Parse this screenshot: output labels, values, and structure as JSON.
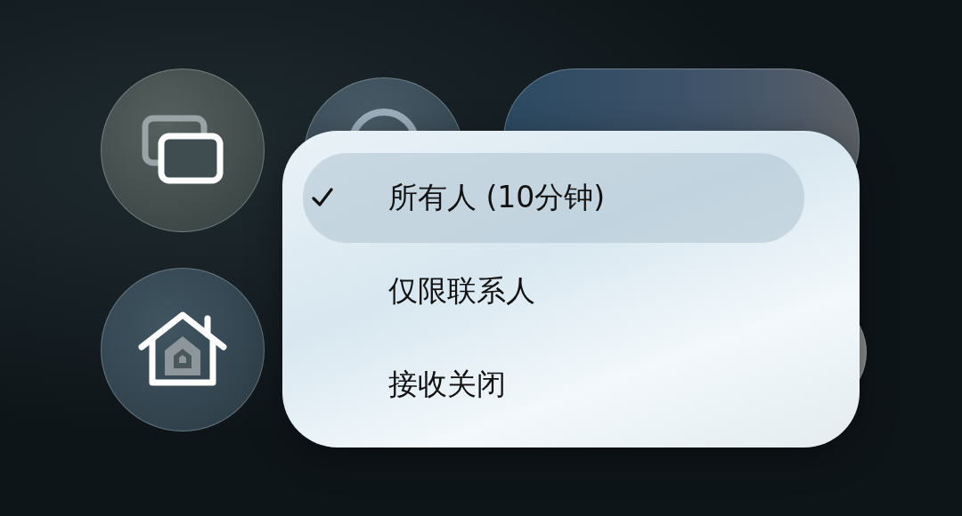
{
  "menu": {
    "items": [
      {
        "label": "所有人 (10分钟)",
        "selected": true
      },
      {
        "label": "仅限联系人",
        "selected": false
      },
      {
        "label": "接收关闭",
        "selected": false
      }
    ]
  }
}
